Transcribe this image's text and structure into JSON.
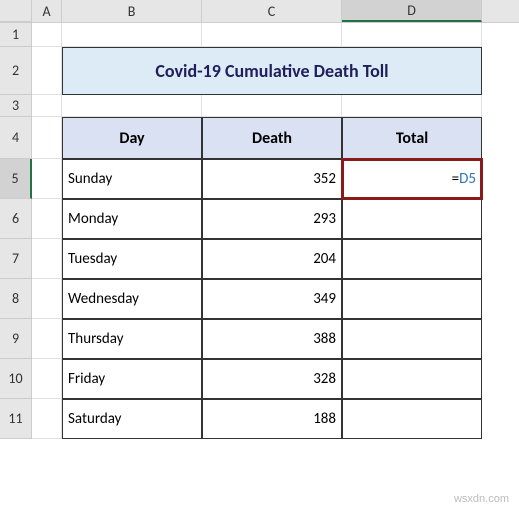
{
  "columns": [
    "A",
    "B",
    "C",
    "D"
  ],
  "rows": [
    "1",
    "2",
    "3",
    "4",
    "5",
    "6",
    "7",
    "8",
    "9",
    "10",
    "11"
  ],
  "title": "Covid-19 Cumulative Death Toll",
  "headers": {
    "day": "Day",
    "death": "Death",
    "total": "Total"
  },
  "data": [
    {
      "day": "Sunday",
      "death": "352"
    },
    {
      "day": "Monday",
      "death": "293"
    },
    {
      "day": "Tuesday",
      "death": "204"
    },
    {
      "day": "Wednesday",
      "death": "349"
    },
    {
      "day": "Thursday",
      "death": "388"
    },
    {
      "day": "Friday",
      "death": "328"
    },
    {
      "day": "Saturday",
      "death": "188"
    }
  ],
  "active_cell": {
    "formula_eq": "=",
    "formula_ref": "D5"
  },
  "watermark": "wsxdn.com",
  "chart_data": {
    "type": "table",
    "title": "Covid-19 Cumulative Death Toll",
    "categories": [
      "Sunday",
      "Monday",
      "Tuesday",
      "Wednesday",
      "Thursday",
      "Friday",
      "Saturday"
    ],
    "series": [
      {
        "name": "Death",
        "values": [
          352,
          293,
          204,
          349,
          388,
          328,
          188
        ]
      }
    ]
  }
}
